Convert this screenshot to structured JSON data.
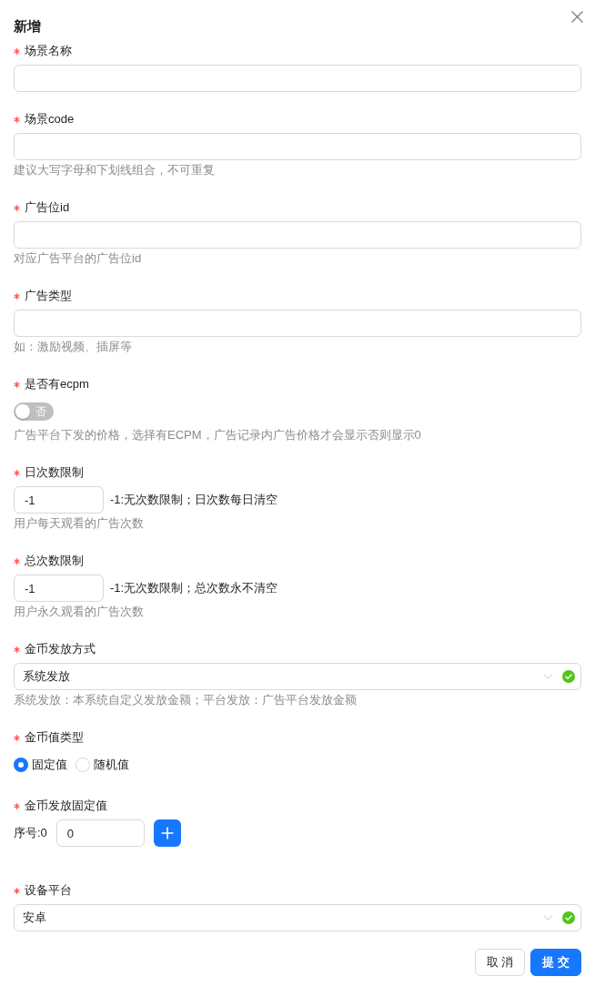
{
  "dialog": {
    "title": "新增"
  },
  "fields": [
    {
      "kind": "text",
      "label": "场景名称",
      "required": true
    },
    {
      "kind": "text",
      "label": "场景code",
      "required": true,
      "hint": "建议大写字母和下划线组合，不可重复"
    },
    {
      "kind": "text",
      "label": "广告位id",
      "required": true,
      "hint": "对应广告平台的广告位id"
    },
    {
      "kind": "text",
      "label": "广告类型",
      "required": true,
      "hint": "如：激励视频、插屏等"
    },
    {
      "kind": "switch",
      "label": "是否有ecpm",
      "required": true,
      "on": false,
      "switch_text": "否",
      "hint": "广告平台下发的价格，选择有ECPM，广告记录内广告价格才会显示否则显示0"
    },
    {
      "kind": "number",
      "label": "日次数限制",
      "required": true,
      "value": "-1",
      "note": "-1:无次数限制；日次数每日清空",
      "hint": "用户每天观看的广告次数"
    },
    {
      "kind": "number",
      "label": "总次数限制",
      "required": true,
      "value": "-1",
      "note": "-1:无次数限制；总次数永不清空",
      "hint": "用户永久观看的广告次数"
    },
    {
      "kind": "select",
      "label": "金币发放方式",
      "required": true,
      "value": "系统发放",
      "valid": true,
      "hint": "系统发放：本系统自定义发放金额；平台发放：广告平台发放金额"
    },
    {
      "kind": "radio",
      "label": "金币值类型",
      "required": true,
      "options": [
        {
          "label": "固定值",
          "selected": true
        },
        {
          "label": "随机值",
          "selected": false
        }
      ]
    },
    {
      "kind": "list",
      "label": "金币发放固定值",
      "required": true,
      "rows": [
        {
          "index_label": "序号:0",
          "value": "0"
        }
      ]
    },
    {
      "kind": "select",
      "label": "设备平台",
      "required": true,
      "value": "安卓",
      "valid": true
    }
  ],
  "buttons": [
    {
      "label": "取 消",
      "kind": "default"
    },
    {
      "label": "提 交",
      "kind": "primary"
    }
  ]
}
